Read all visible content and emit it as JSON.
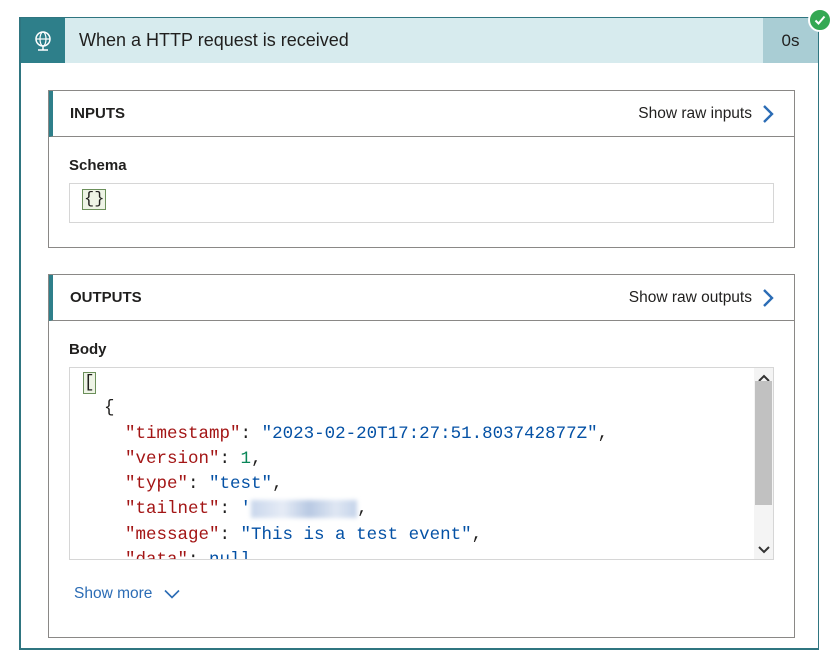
{
  "header": {
    "title": "When a HTTP request is received",
    "duration": "0s"
  },
  "inputs": {
    "title": "INPUTS",
    "raw_link": "Show raw inputs",
    "schema_label": "Schema",
    "schema_value": "{}"
  },
  "outputs": {
    "title": "OUTPUTS",
    "raw_link": "Show raw outputs",
    "body_label": "Body",
    "code": {
      "open_bracket": "[",
      "open_brace": "{",
      "lines": [
        {
          "key": "\"timestamp\"",
          "value": "\"2023-02-20T17:27:51.803742877Z\"",
          "type": "string"
        },
        {
          "key": "\"version\"",
          "value": "1",
          "type": "number"
        },
        {
          "key": "\"type\"",
          "value": "\"test\"",
          "type": "string"
        },
        {
          "key": "\"tailnet\"",
          "value": "'",
          "type": "redacted"
        },
        {
          "key": "\"message\"",
          "value": "\"This is a test event\"",
          "type": "string"
        },
        {
          "key": "\"data\"",
          "value": "null",
          "type": "null"
        }
      ]
    },
    "show_more": "Show more"
  },
  "colors": {
    "accent": "#2e7f8a",
    "header_bg": "#d7ebee",
    "status_success": "#34a853",
    "link": "#2b6cb5"
  }
}
